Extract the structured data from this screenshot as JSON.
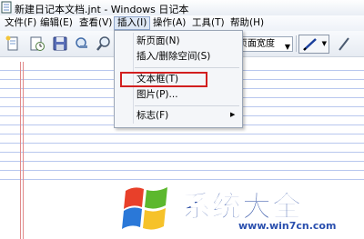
{
  "window": {
    "title": "新建日记本文档.jnt - Windows 日记本"
  },
  "menubar": {
    "items": [
      "文件(F)",
      "编辑(E)",
      "查看(V)",
      "插入(I)",
      "操作(A)",
      "工具(T)",
      "帮助(H)"
    ],
    "active": "插入(I)"
  },
  "toolbar": {
    "buttons": [
      "new-page-icon",
      "clock-icon",
      "save-icon",
      "zoom-icon",
      "search-icon"
    ],
    "zoom_value": "页面宽度",
    "pen_tool": "pen-icon"
  },
  "insert_menu": {
    "items": [
      "新页面(N)",
      "插入/删除空间(S)",
      "文本框(T)",
      "图片(P)...",
      "标志(F)"
    ],
    "highlighted": "文本框(T)",
    "submenu_item": "标志(F)"
  },
  "watermark": {
    "text": "系统大全",
    "url": "www.win7cn.com"
  },
  "colors": {
    "highlight": "#d21f1f",
    "rule_line": "#b8c7ee",
    "margin_line": "#e08a8a",
    "watermark": "#1a3f9c"
  }
}
